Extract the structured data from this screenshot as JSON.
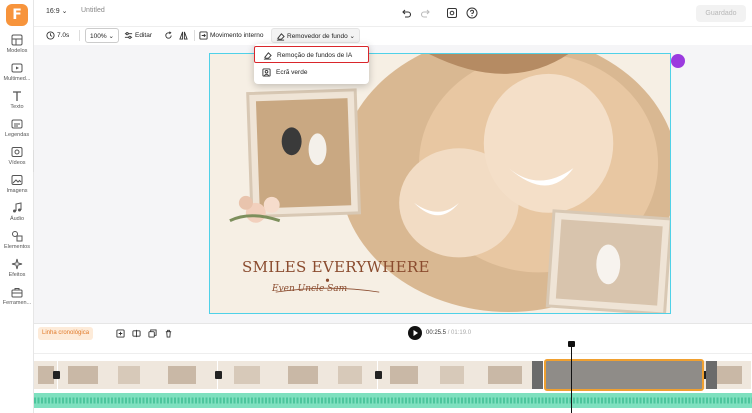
{
  "app": {
    "logo_letter": "F",
    "brand_color": "#f7943c",
    "accent_color": "#4fd1e8",
    "highlight_color": "#d9262b"
  },
  "sidebar": {
    "items": [
      {
        "label": "Modelos",
        "icon": "template-icon"
      },
      {
        "label": "Multimed...",
        "icon": "media-icon"
      },
      {
        "label": "Texto",
        "icon": "text-icon"
      },
      {
        "label": "Legendas",
        "icon": "subtitles-icon"
      },
      {
        "label": "Vídeos",
        "icon": "video-icon"
      },
      {
        "label": "Imagens",
        "icon": "image-icon"
      },
      {
        "label": "Áudio",
        "icon": "music-icon"
      },
      {
        "label": "Elementos",
        "icon": "elements-icon"
      },
      {
        "label": "Efeitos",
        "icon": "effects-icon"
      },
      {
        "label": "Ferramen...",
        "icon": "toolbox-icon"
      }
    ]
  },
  "topbar": {
    "aspect_ratio": "16:9",
    "project_title": "Untitled",
    "save_label": "Guardado"
  },
  "toolbar": {
    "duration": "7.0s",
    "zoom": "100%",
    "edit_label": "Editar",
    "motion_label": "Movimento interno",
    "bg_remover_label": "Removedor de fundo"
  },
  "dropdown": {
    "items": [
      {
        "label": "Remoção de fundos de IA",
        "icon": "ai-remove-bg-icon",
        "highlighted": true
      },
      {
        "label": "Ecrã verde",
        "icon": "green-screen-icon",
        "highlighted": false
      }
    ]
  },
  "canvas": {
    "headline": "SMILES EVERYWHERE",
    "subtitle": "Even Uncle Sam"
  },
  "timeline": {
    "label": "Linha cronológica",
    "current_time": "00:25.5",
    "total_time": "/ 01:19.0",
    "audio_color": "#7ee0bf",
    "selected_clip_border": "#f0a030"
  }
}
